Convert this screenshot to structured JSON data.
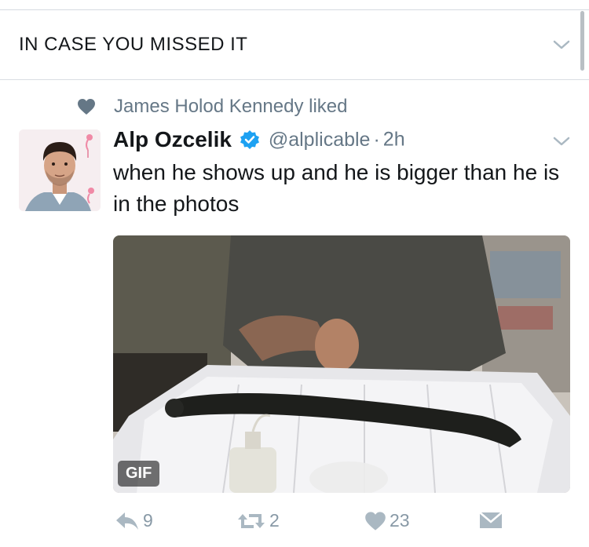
{
  "section": {
    "title": "IN CASE YOU MISSED IT"
  },
  "social_context": {
    "text": "James Holod Kennedy liked"
  },
  "tweet": {
    "author_name": "Alp Ozcelik",
    "handle": "@alplicable",
    "separator": "·",
    "time": "2h",
    "text": "when he shows up and he is bigger than he is in the photos",
    "media_badge": "GIF"
  },
  "actions": {
    "reply_count": "9",
    "retweet_count": "2",
    "like_count": "23"
  },
  "icons": {
    "chevron": "chevron-down-icon",
    "liked": "heart-icon",
    "verified": "verified-badge-icon",
    "reply": "reply-icon",
    "retweet": "retweet-icon",
    "like": "heart-icon",
    "dm": "direct-message-icon"
  },
  "colors": {
    "accent_blue": "#1da1f2",
    "secondary_text": "#657786",
    "action_gray": "#8899a6",
    "divider": "#d9dee3"
  }
}
